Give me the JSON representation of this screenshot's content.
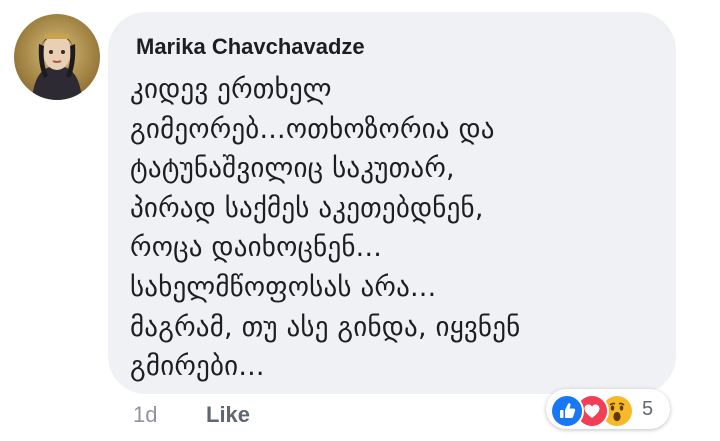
{
  "comment": {
    "author": "Marika Chavchavadze",
    "lines": [
      "კიდევ ერთხელ",
      "გიმეორებ...ოთხოზორია და",
      "ტატუნაშვილიც საკუთარ,",
      "პირად საქმეს აკეთებდნენ,",
      "როცა დაიხოცნენ...",
      "სახელმწოფოსას არა...",
      "მაგრამ, თუ ასე გინდა, იყვნენ",
      "გმირები..."
    ],
    "time": "1d",
    "like_label": "Like",
    "reactions": {
      "icons": [
        "like-icon",
        "love-icon",
        "wow-icon"
      ],
      "count": "5"
    }
  },
  "colors": {
    "bubble": "#eff1f4",
    "like": "#1877f2",
    "love": "#f33e58",
    "wow": "#f7b928"
  }
}
